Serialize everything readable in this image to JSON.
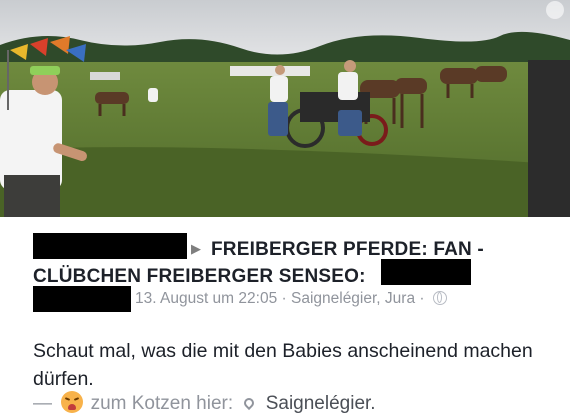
{
  "post": {
    "page_name": "FREIBERGER PFERDE: FAN - CLÜBCHEN FREIBERGER SENSEO:",
    "date": "13. August um 22:05",
    "separator": "·",
    "location": "Saignelégier, Jura",
    "privacy_icon": "globe-icon",
    "message": "Schaut mal, was die mit den Babies anscheinend machen dürfen.",
    "feeling_prefix": "—",
    "feeling_icon": "nauseated-face-emoji",
    "feeling_text": "zum Kotzen hier:",
    "feeling_location_icon": "location-pin-icon",
    "feeling_location": "Saignelégier."
  },
  "photo": {
    "description_icon": "photo"
  },
  "colors": {
    "text": "#1d2129",
    "meta": "#90949c",
    "redaction": "#000000"
  }
}
